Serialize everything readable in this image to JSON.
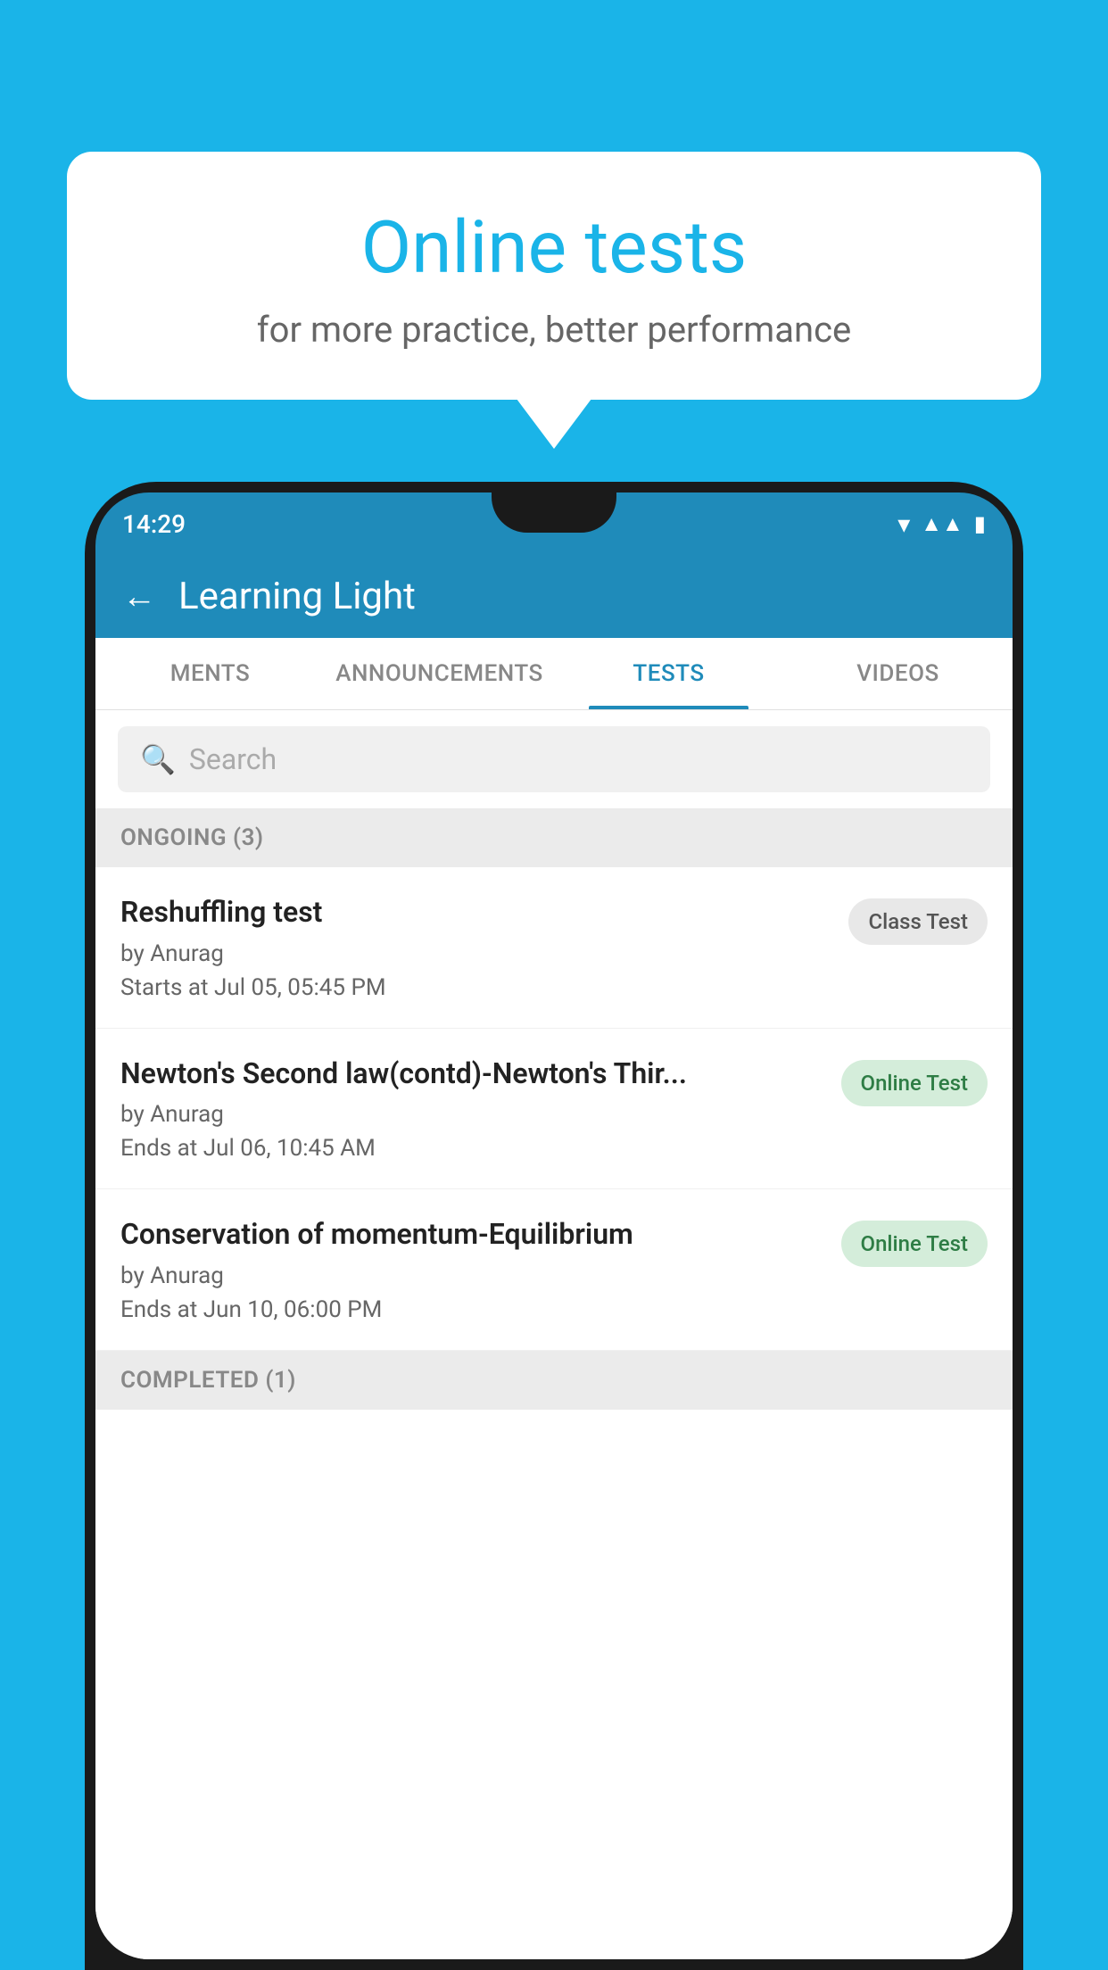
{
  "background_color": "#1ab4e8",
  "speech_bubble": {
    "title": "Online tests",
    "subtitle": "for more practice, better performance"
  },
  "phone": {
    "status_bar": {
      "time": "14:29"
    },
    "app_header": {
      "title": "Learning Light",
      "back_label": "←"
    },
    "tabs": [
      {
        "label": "MENTS",
        "active": false
      },
      {
        "label": "ANNOUNCEMENTS",
        "active": false
      },
      {
        "label": "TESTS",
        "active": true
      },
      {
        "label": "VIDEOS",
        "active": false
      }
    ],
    "search": {
      "placeholder": "Search"
    },
    "ongoing_section": {
      "label": "ONGOING (3)"
    },
    "tests": [
      {
        "name": "Reshuffling test",
        "author": "by Anurag",
        "time_label": "Starts at",
        "time": "Jul 05, 05:45 PM",
        "badge": "Class Test",
        "badge_type": "class"
      },
      {
        "name": "Newton's Second law(contd)-Newton's Thir...",
        "author": "by Anurag",
        "time_label": "Ends at",
        "time": "Jul 06, 10:45 AM",
        "badge": "Online Test",
        "badge_type": "online"
      },
      {
        "name": "Conservation of momentum-Equilibrium",
        "author": "by Anurag",
        "time_label": "Ends at",
        "time": "Jun 10, 06:00 PM",
        "badge": "Online Test",
        "badge_type": "online"
      }
    ],
    "completed_section": {
      "label": "COMPLETED (1)"
    }
  }
}
